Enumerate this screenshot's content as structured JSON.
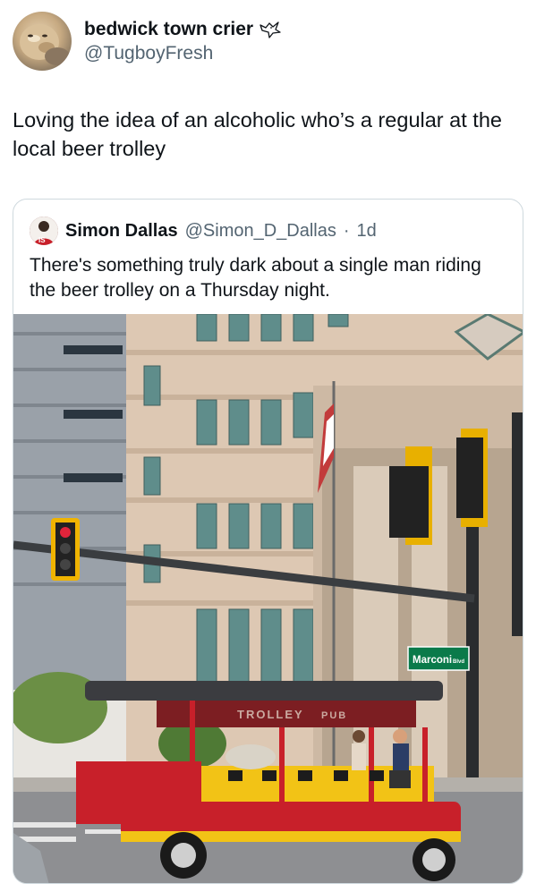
{
  "tweet": {
    "author": {
      "display_name": "bedwick town crier",
      "handle": "@TugboyFresh",
      "badge_icon": "bird-outline-icon"
    },
    "text": "Loving the idea of an alcoholic who’s a regular at the local beer trolley"
  },
  "quoted_tweet": {
    "author": {
      "display_name": "Simon Dallas",
      "handle": "@Simon_D_Dallas",
      "avatar_badge": "IS"
    },
    "separator": "·",
    "time": "1d",
    "text": "There's something truly dark about a single man riding the beer trolley on a Thursday night.",
    "photo": {
      "street_sign": "Marconi",
      "street_sign_suffix": "Blvd",
      "trolley_lettering": "TROLLEY",
      "trolley_lettering_2": "PUB"
    }
  },
  "colors": {
    "text_primary": "#0f1419",
    "text_secondary": "#536471",
    "border": "#cfd9de",
    "street_sign_green": "#0a7a4a",
    "trolley_red": "#c8202a",
    "trolley_yellow": "#f2c316"
  }
}
